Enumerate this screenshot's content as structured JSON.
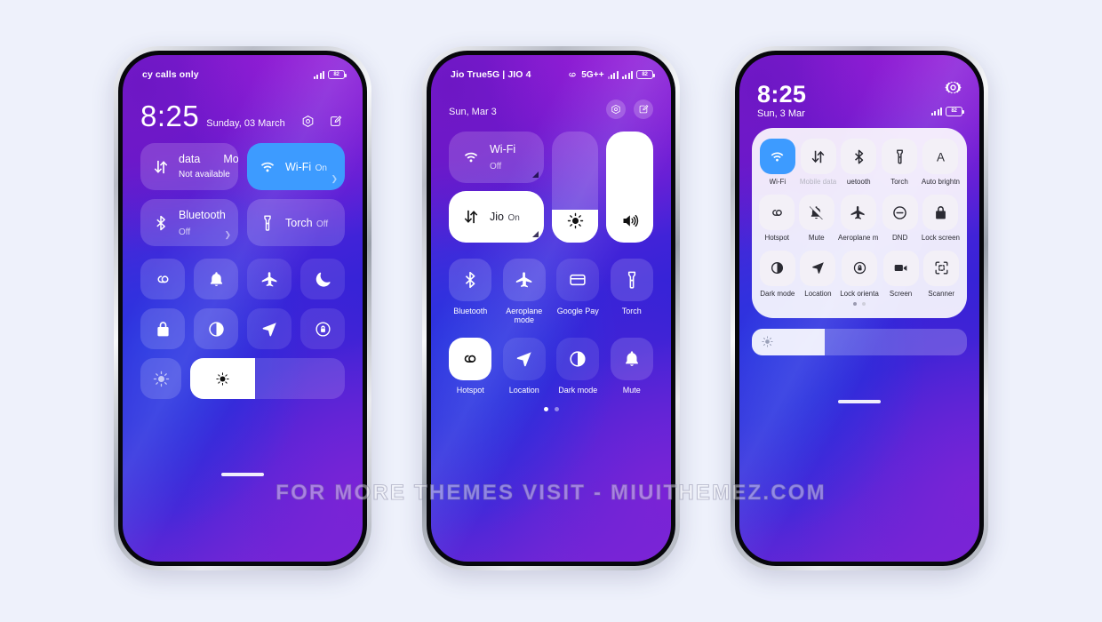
{
  "watermark": "FOR MORE THEMES VISIT - MIUITHEMEZ.COM",
  "phone1": {
    "status": {
      "carrier": "cy calls only",
      "battery": "82"
    },
    "header": {
      "time": "8:25",
      "date": "Sunday, 03 March",
      "record_icon": "screen-record-icon",
      "edit_icon": "edit-icon"
    },
    "big_tiles": [
      {
        "title": "data",
        "title2": "Mo",
        "sub": "Not available",
        "icon": "mobile-data-icon",
        "state": "off"
      },
      {
        "title": "Wi-Fi",
        "sub": "On",
        "icon": "wifi-icon",
        "state": "on"
      },
      {
        "title": "Bluetooth",
        "sub": "Off",
        "icon": "bluetooth-icon",
        "state": "off"
      },
      {
        "title": "Torch",
        "sub": "Off",
        "icon": "torch-icon",
        "state": "off"
      }
    ],
    "small_tiles_row1": [
      {
        "icon": "hotspot-icon"
      },
      {
        "icon": "bell-icon"
      },
      {
        "icon": "aeroplane-icon"
      },
      {
        "icon": "moon-icon"
      }
    ],
    "small_tiles_row2": [
      {
        "icon": "lock-icon"
      },
      {
        "icon": "dark-mode-icon"
      },
      {
        "icon": "location-icon"
      },
      {
        "icon": "lock-orientation-icon"
      }
    ],
    "brightness": {
      "icon": "auto-brightness-icon",
      "slider_icon": "brightness-icon",
      "value": 42
    }
  },
  "phone2": {
    "status": {
      "carrier": "Jio True5G | JIO 4",
      "network": "5G++",
      "battery": "82"
    },
    "header": {
      "date": "Sun, Mar 3",
      "record_icon": "screen-record-icon",
      "edit_icon": "edit-icon"
    },
    "wide_tiles": [
      {
        "title": "Wi-Fi",
        "sub": "Off",
        "icon": "wifi-icon",
        "state": "off"
      },
      {
        "title": "Jio",
        "sub": "On",
        "icon": "mobile-data-icon",
        "state": "on"
      }
    ],
    "sliders": [
      {
        "name": "brightness",
        "icon": "brightness-icon",
        "value": 30,
        "style": "translucent"
      },
      {
        "name": "volume",
        "icon": "volume-icon",
        "value": 100,
        "style": "white"
      }
    ],
    "grid_row1": [
      {
        "label": "Bluetooth",
        "icon": "bluetooth-icon",
        "state": "off",
        "corner": true
      },
      {
        "label": "Aeroplane\nmode",
        "icon": "aeroplane-icon",
        "state": "off"
      },
      {
        "label": "Google Pay",
        "icon": "google-pay-icon",
        "state": "off"
      },
      {
        "label": "Torch",
        "icon": "torch-icon",
        "state": "off"
      }
    ],
    "grid_row2": [
      {
        "label": "Hotspot",
        "icon": "hotspot-icon",
        "state": "on"
      },
      {
        "label": "Location",
        "icon": "location-icon",
        "state": "off"
      },
      {
        "label": "Dark mode",
        "icon": "dark-mode-icon",
        "state": "off"
      },
      {
        "label": "Mute",
        "icon": "bell-icon",
        "state": "off"
      }
    ],
    "page_dots": {
      "count": 2,
      "active": 0
    }
  },
  "phone3": {
    "header": {
      "time": "8:25",
      "date": "Sun, 3 Mar",
      "gear_icon": "gear-icon",
      "battery": "82"
    },
    "grid_row1": [
      {
        "label": "Wi-Fi",
        "icon": "wifi-icon",
        "state": "on"
      },
      {
        "label": "Mobile data",
        "icon": "mobile-data-icon",
        "state": "disabled"
      },
      {
        "label": "uetooth",
        "icon": "bluetooth-icon",
        "state": "off"
      },
      {
        "label": "Torch",
        "icon": "torch-icon",
        "state": "off"
      },
      {
        "label": "Auto brightn",
        "icon": "auto-brightness-icon",
        "state": "off"
      }
    ],
    "grid_row2": [
      {
        "label": "Hotspot",
        "icon": "hotspot-icon",
        "state": "off"
      },
      {
        "label": "Mute",
        "icon": "bell-muted-icon",
        "state": "off"
      },
      {
        "label": "Aeroplane m",
        "icon": "aeroplane-icon",
        "state": "off"
      },
      {
        "label": "DND",
        "icon": "dnd-icon",
        "state": "off"
      },
      {
        "label": "Lock screen",
        "icon": "lock-icon",
        "state": "off"
      }
    ],
    "grid_row3": [
      {
        "label": "Dark mode",
        "icon": "dark-mode-icon",
        "state": "off"
      },
      {
        "label": "Location",
        "icon": "location-icon",
        "state": "off"
      },
      {
        "label": "Lock orienta",
        "icon": "lock-orientation-icon",
        "state": "off"
      },
      {
        "label": "Screen",
        "icon": "screen-record-cam-icon",
        "state": "off"
      },
      {
        "label": "Scanner",
        "icon": "scanner-icon",
        "state": "off"
      }
    ],
    "page_dots": {
      "count": 2,
      "active": 0
    },
    "brightness": {
      "icon": "brightness-icon",
      "value": 34
    }
  }
}
